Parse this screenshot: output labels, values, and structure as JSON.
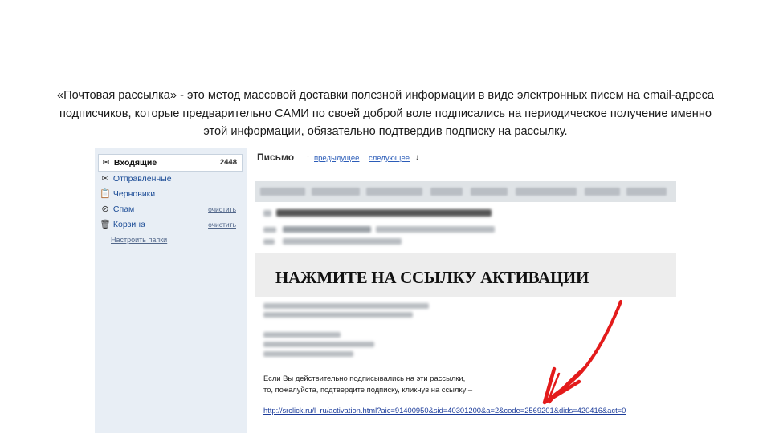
{
  "caption": {
    "line1": "«Почтовая рассылка» - это метод массовой доставки полезной информации в виде электронных писем на email-адреса",
    "line2": "подписчиков, которые предварительно САМИ по своей доброй воле подписались на периодическое получение именно",
    "line3": "этой информации, обязательно подтвердив подписку на рассылку."
  },
  "sidebar": {
    "folders": [
      {
        "label": "Входящие",
        "icon": "envelope-icon",
        "count": "2448"
      },
      {
        "label": "Отправленные",
        "icon": "sent-icon"
      },
      {
        "label": "Черновики",
        "icon": "drafts-icon"
      },
      {
        "label": "Спам",
        "icon": "spam-icon",
        "action": "очистить"
      },
      {
        "label": "Корзина",
        "icon": "trash-icon",
        "action": "очистить"
      }
    ],
    "settings": "Настроить папки"
  },
  "mail": {
    "title": "Письмо",
    "prev": "предыдущее",
    "next": "следующее",
    "banner": "НАЖМИТЕ НА ССЫЛКУ АКТИВАЦИИ",
    "body_line1": "Если Вы действительно подписывались на эти рассылки,",
    "body_line2": "то, пожалуйста, подтвердите подписку, кликнув на ссылку –",
    "activation_link": "http://srclick.ru/l_ru/activation.html?aic=91400950&sid=40301200&a=2&code=2569201&dids=420416&act=0"
  },
  "colors": {
    "sidebar_bg": "#e8eef5",
    "link": "#1d3d9b",
    "annotation_arrow": "#e31b1b"
  }
}
